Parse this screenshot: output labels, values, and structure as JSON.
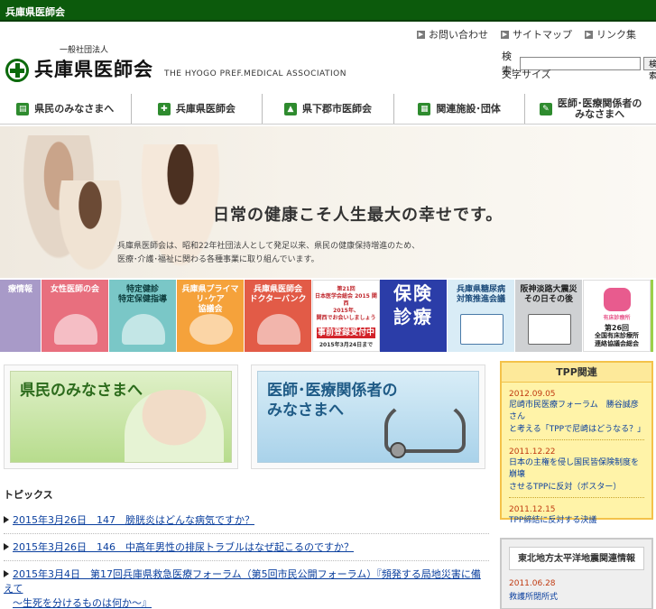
{
  "topbar": {
    "title": "兵庫県医師会"
  },
  "util_links": [
    "お問い合わせ",
    "サイトマップ",
    "リンク集"
  ],
  "logo": {
    "corp": "一般社団法人",
    "name": "兵庫県医師会",
    "english": "THE HYOGO PREF.MEDICAL ASSOCIATION"
  },
  "search": {
    "label": "検索:",
    "button": "検索",
    "value": ""
  },
  "font_size_label": "文字サイズ",
  "gnav": [
    {
      "label": "県民のみなさまへ",
      "icon": "book-icon"
    },
    {
      "label": "兵庫県医師会",
      "icon": "medical-cross-icon"
    },
    {
      "label": "県下郡市医師会",
      "icon": "map-icon"
    },
    {
      "label": "関連施設･団体",
      "icon": "building-icon"
    },
    {
      "label": "医師･医療関係者の\nみなさまへ",
      "icon": "pen-icon"
    }
  ],
  "hero": {
    "slogan": "日常の健康こそ人生最大の幸せです。",
    "desc_line1": "兵庫県医師会は、昭和22年社団法人として発足以来、県民の健康保持増進のため、",
    "desc_line2": "医療･介護･福祉に関わる各種事業に取り組んでいます。"
  },
  "banners": [
    {
      "lines": [
        "療情報"
      ]
    },
    {
      "lines": [
        "女性医師の会"
      ]
    },
    {
      "lines": [
        "特定健診",
        "特定保健指導"
      ]
    },
    {
      "lines": [
        "兵庫県プライマリ･ケア",
        "協議会"
      ]
    },
    {
      "lines": [
        "兵庫県医師会",
        "ドクターバンク"
      ]
    },
    {
      "lines": [
        "第21回",
        "日本医学会総会 2015 関西",
        "2015年、",
        "関西でお会いしましょう"
      ],
      "register": "事前登録受付中",
      "date": "2015年3月24日まで"
    },
    {
      "lines": [
        "保険",
        "診療"
      ]
    },
    {
      "lines": [
        "兵庫県糖尿病",
        "対策推進会議"
      ]
    },
    {
      "lines": [
        "阪神淡路大震災",
        "その日その後"
      ]
    },
    {
      "lines": [
        "第26回",
        "全国有床診療所",
        "連絡協議会総会"
      ],
      "sub": "有床診療所"
    }
  ],
  "cards": [
    {
      "title": "県民のみなさまへ"
    },
    {
      "title_line1": "医師･医療関係者の",
      "title_line2": "みなさまへ"
    }
  ],
  "topics": {
    "heading": "トピックス",
    "items": [
      {
        "text": "2015年3月26日　147　膀胱炎はどんな病気ですか？"
      },
      {
        "text": "2015年3月26日　146　中高年男性の排尿トラブルはなぜ起こるのですか？"
      },
      {
        "text_line1": "2015年3月4日　第17回兵庫県救急医療フォーラム（第5回市民公開フォーラム）『頻発する局地災害に備えて",
        "text_line2": "～生死を分けるものは何か～』"
      }
    ]
  },
  "tpp": {
    "heading": "TPP関連",
    "entries": [
      {
        "date": "2012.09.05",
        "line1": "尼崎市民医療フォーラム　勝谷誠彦さん",
        "line2": "と考える「TPPで尼崎はどうなる？」"
      },
      {
        "date": "2011.12.22",
        "line1": "日本の主権を侵し国民皆保険制度を崩壊",
        "line2": "させるTPPに反対（ポスター）"
      },
      {
        "date": "2011.12.15",
        "line1": "TPP締結に反対する決議"
      }
    ]
  },
  "quake": {
    "heading": "東北地方太平洋地震関連情報",
    "date": "2011.06.28",
    "link": "救護所閉所式"
  }
}
